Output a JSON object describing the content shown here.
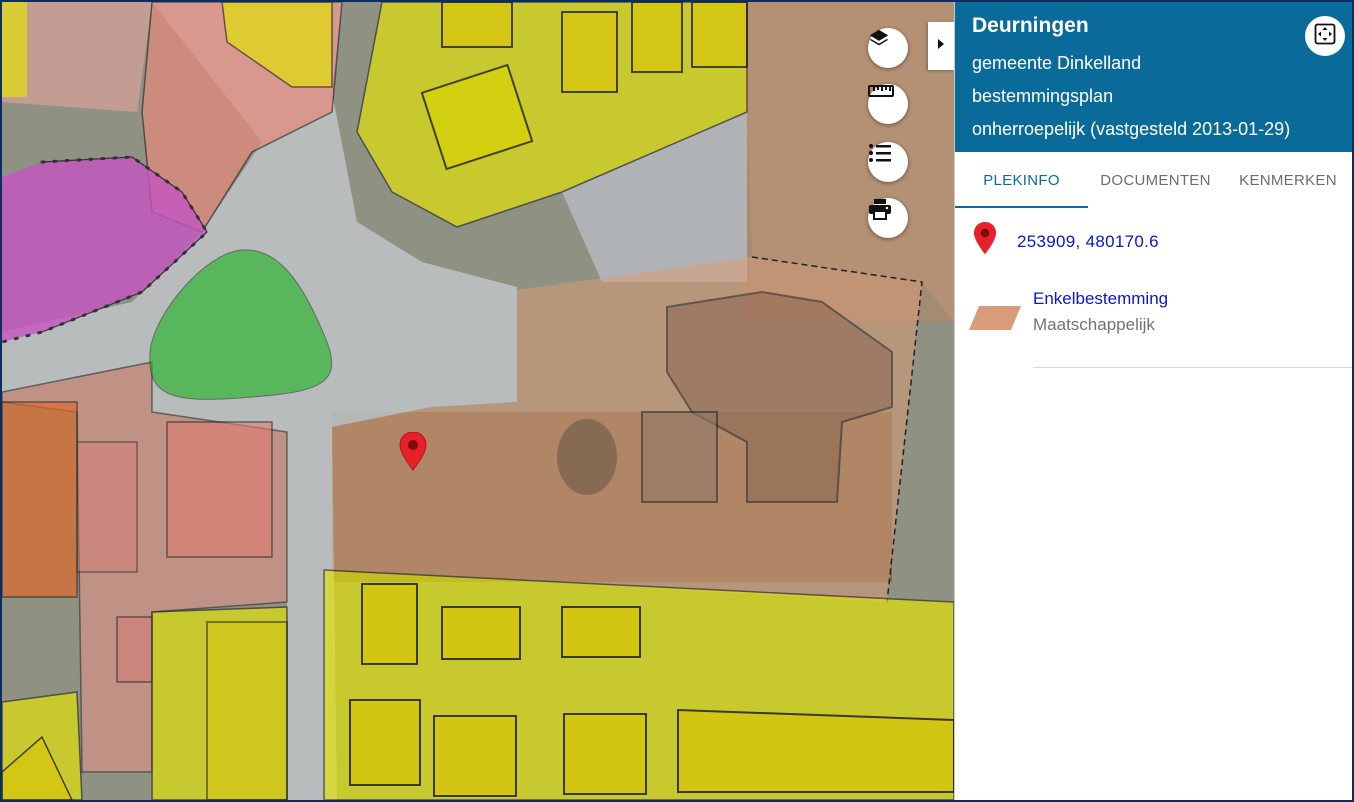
{
  "map": {
    "marker": "red-location-marker",
    "controls": [
      {
        "name": "layers-button",
        "icon": "layers-icon"
      },
      {
        "name": "measure-button",
        "icon": "ruler-icon"
      },
      {
        "name": "legend-button",
        "icon": "list-icon"
      },
      {
        "name": "print-button",
        "icon": "printer-icon"
      }
    ],
    "colors": {
      "wonen": "#e1e10c",
      "maatschappelijk": "#d8a07a",
      "centrum": "#e69a86",
      "groen": "#19b41e",
      "bedrijf": "#c455c3",
      "gemengd": "#e06a2a",
      "verkeer": "#c2c4c9"
    }
  },
  "panel": {
    "place": "Deurningen",
    "municipality": "gemeente Dinkelland",
    "plan_type": "bestemmingsplan",
    "status": "onherroepelijk (vastgesteld 2013-01-29)",
    "tabs": [
      "PLEKINFO",
      "DOCUMENTEN",
      "KENMERKEN"
    ],
    "active_tab": "PLEKINFO",
    "coordinates": "253909, 480170.6",
    "destination": {
      "name": "Enkelbestemming",
      "value": "Maatschappelijk",
      "color": "#d99c78"
    }
  }
}
